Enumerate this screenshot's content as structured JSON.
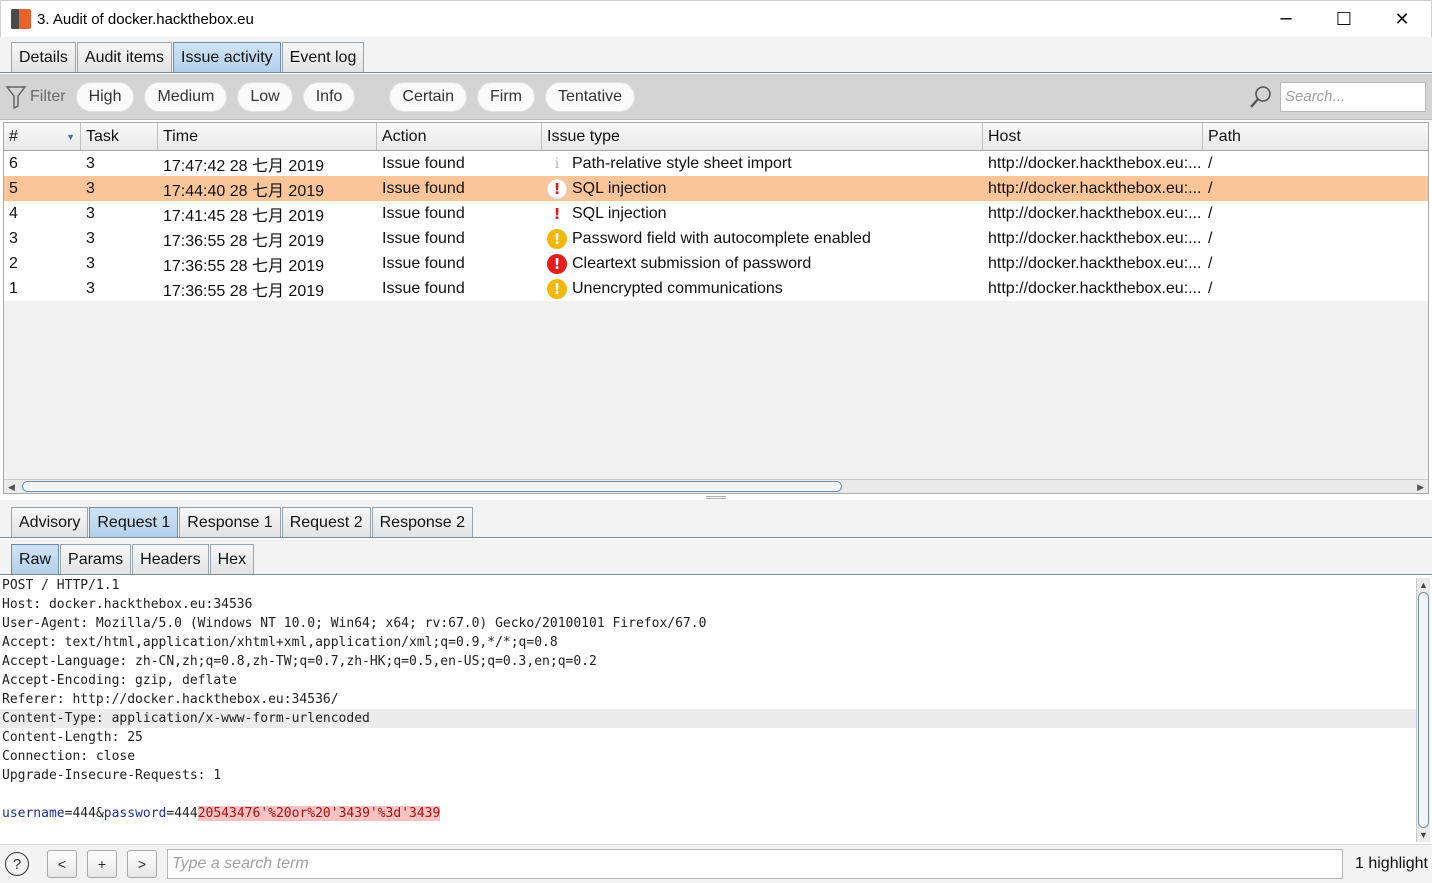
{
  "window": {
    "title": "3. Audit of docker.hackthebox.eu",
    "controls": {
      "minimize": "─",
      "maximize": "☐",
      "close": "✕"
    }
  },
  "top_tabs": [
    {
      "label": "Details",
      "active": false
    },
    {
      "label": "Audit items",
      "active": false
    },
    {
      "label": "Issue activity",
      "active": true
    },
    {
      "label": "Event log",
      "active": false
    }
  ],
  "filter": {
    "label": "Filter",
    "severity_chips": [
      "High",
      "Medium",
      "Low",
      "Info"
    ],
    "confidence_chips": [
      "Certain",
      "Firm",
      "Tentative"
    ],
    "search_placeholder": "Search..."
  },
  "table": {
    "columns": [
      "#",
      "Task",
      "Time",
      "Action",
      "Issue type",
      "Host",
      "Path"
    ],
    "rows": [
      {
        "num": "6",
        "task": "3",
        "time": "17:47:42 28 七月 2019",
        "action": "Issue found",
        "severity": "info",
        "severity_glyph": "i",
        "issue": "Path-relative style sheet import",
        "host": "http://docker.hackthebox.eu:...",
        "path": "/",
        "selected": false
      },
      {
        "num": "5",
        "task": "3",
        "time": "17:44:40 28 七月 2019",
        "action": "Issue found",
        "severity": "high",
        "severity_glyph": "!",
        "issue": "SQL injection",
        "host": "http://docker.hackthebox.eu:...",
        "path": "/",
        "selected": true
      },
      {
        "num": "4",
        "task": "3",
        "time": "17:41:45 28 七月 2019",
        "action": "Issue found",
        "severity": "high-red",
        "severity_glyph": "!",
        "issue": "SQL injection",
        "host": "http://docker.hackthebox.eu:...",
        "path": "/",
        "selected": false
      },
      {
        "num": "3",
        "task": "3",
        "time": "17:36:55 28 七月 2019",
        "action": "Issue found",
        "severity": "medium",
        "severity_glyph": "!",
        "issue": "Password field with autocomplete enabled",
        "host": "http://docker.hackthebox.eu:...",
        "path": "/",
        "selected": false
      },
      {
        "num": "2",
        "task": "3",
        "time": "17:36:55 28 七月 2019",
        "action": "Issue found",
        "severity": "crit",
        "severity_glyph": "!",
        "issue": "Cleartext submission of password",
        "host": "http://docker.hackthebox.eu:...",
        "path": "/",
        "selected": false
      },
      {
        "num": "1",
        "task": "3",
        "time": "17:36:55 28 七月 2019",
        "action": "Issue found",
        "severity": "medium",
        "severity_glyph": "!",
        "issue": "Unencrypted communications",
        "host": "http://docker.hackthebox.eu:...",
        "path": "/",
        "selected": false
      }
    ]
  },
  "detail_tabs": [
    {
      "label": "Advisory",
      "active": false
    },
    {
      "label": "Request 1",
      "active": true
    },
    {
      "label": "Response 1",
      "active": false
    },
    {
      "label": "Request 2",
      "active": false
    },
    {
      "label": "Response 2",
      "active": false
    }
  ],
  "view_tabs": [
    {
      "label": "Raw",
      "active": true
    },
    {
      "label": "Params",
      "active": false
    },
    {
      "label": "Headers",
      "active": false
    },
    {
      "label": "Hex",
      "active": false
    }
  ],
  "raw_request": {
    "lines": [
      "POST / HTTP/1.1",
      "Host: docker.hackthebox.eu:34536",
      "User-Agent: Mozilla/5.0 (Windows NT 10.0; Win64; x64; rv:67.0) Gecko/20100101 Firefox/67.0",
      "Accept: text/html,application/xhtml+xml,application/xml;q=0.9,*/*;q=0.8",
      "Accept-Language: zh-CN,zh;q=0.8,zh-TW;q=0.7,zh-HK;q=0.5,en-US;q=0.3,en;q=0.2",
      "Accept-Encoding: gzip, deflate",
      "Referer: http://docker.hackthebox.eu:34536/",
      "Content-Type: application/x-www-form-urlencoded",
      "Content-Length: 25",
      "Connection: close",
      "Upgrade-Insecure-Requests: 1",
      ""
    ],
    "highlighted_line_index": 7,
    "body": {
      "k1": "username",
      "eq1": "=",
      "v1": "444",
      "amp": "&",
      "k2": "password",
      "eq2": "=",
      "v2_plain": "444",
      "v2_highlight": "20543476'%20or%20'3439'%3d'3439"
    }
  },
  "bottom": {
    "help": "?",
    "prev": "<",
    "add": "+",
    "next": ">",
    "search_placeholder": "Type a search term",
    "highlight_count": "1 highlight"
  }
}
